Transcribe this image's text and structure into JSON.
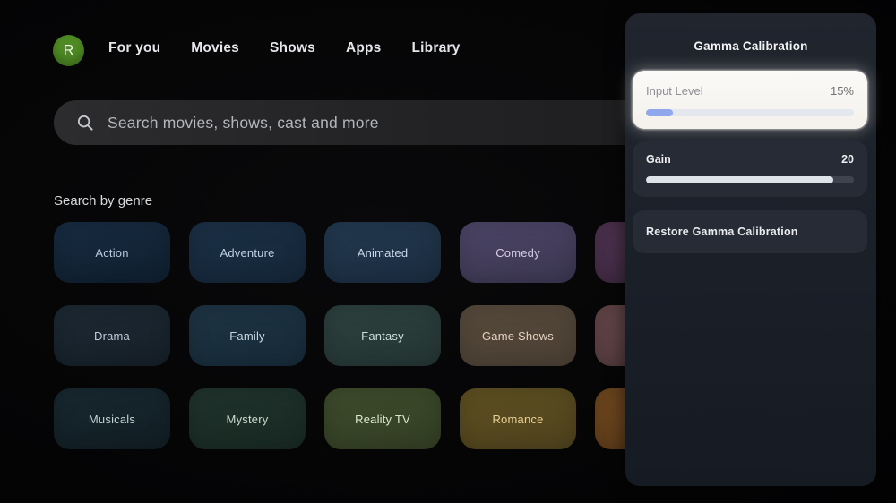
{
  "nav": {
    "avatar_letter": "R",
    "avatar_color": "#4f8b24",
    "items": [
      {
        "label": "For you"
      },
      {
        "label": "Movies"
      },
      {
        "label": "Shows"
      },
      {
        "label": "Apps"
      },
      {
        "label": "Library"
      }
    ]
  },
  "search": {
    "placeholder": "Search movies, shows, cast and more",
    "icon": "search-icon"
  },
  "genre_section": {
    "title": "Search by genre",
    "tiles": [
      {
        "label": "Action",
        "color_top": "#182c42",
        "color_bottom": "#0f1e2e",
        "text_color": "#b6c9e2"
      },
      {
        "label": "Adventure",
        "color_top": "#1b3046",
        "color_bottom": "#142638",
        "text_color": "#bdd0e4"
      },
      {
        "label": "Animated",
        "color_top": "#23394f",
        "color_bottom": "#1a2c40",
        "text_color": "#c8d6e8"
      },
      {
        "label": "Comedy",
        "color_top": "#4d4668",
        "color_bottom": "#3b3650",
        "text_color": "#d6cce6"
      },
      {
        "label": "",
        "color_top": "#4e3350",
        "color_bottom": "#402a42",
        "text_color": "#ffffff"
      },
      {
        "label": "Drama",
        "color_top": "#1d2933",
        "color_bottom": "#151f28",
        "text_color": "#becbd8"
      },
      {
        "label": "Family",
        "color_top": "#1e3444",
        "color_bottom": "#162a38",
        "text_color": "#c6d5e0"
      },
      {
        "label": "Fantasy",
        "color_top": "#2d413f",
        "color_bottom": "#243533",
        "text_color": "#cedfd8"
      },
      {
        "label": "Game Shows",
        "color_top": "#564a3c",
        "color_bottom": "#4a3f33",
        "text_color": "#e4d2c2"
      },
      {
        "label": "",
        "color_top": "#64464a",
        "color_bottom": "#563c3e",
        "text_color": "#ffffff"
      },
      {
        "label": "Musicals",
        "color_top": "#182830",
        "color_bottom": "#111d23",
        "text_color": "#c2d1d4"
      },
      {
        "label": "Mystery",
        "color_top": "#20332c",
        "color_bottom": "#182822",
        "text_color": "#cbdcd2"
      },
      {
        "label": "Reality TV",
        "color_top": "#3e4c2c",
        "color_bottom": "#323e23",
        "text_color": "#dde9cc"
      },
      {
        "label": "Romance",
        "color_top": "#5e5022",
        "color_bottom": "#4e421d",
        "text_color": "#eace94"
      },
      {
        "label": "",
        "color_top": "#70481f",
        "color_bottom": "#5e3c1a",
        "text_color": "#ffffff"
      }
    ]
  },
  "panel": {
    "title": "Gamma Calibration",
    "sliders": [
      {
        "label": "Input Level",
        "value": "15%",
        "percent": 13,
        "focused": true,
        "fill_color": "#8fa7ec",
        "track_color": "#e5e7ee"
      },
      {
        "label": "Gain",
        "value": "20",
        "percent": 90,
        "focused": false,
        "fill_color": "#dde4e9",
        "track_color": "#3e444d"
      }
    ],
    "restore_button": {
      "label": "Restore Gamma Calibration"
    }
  }
}
